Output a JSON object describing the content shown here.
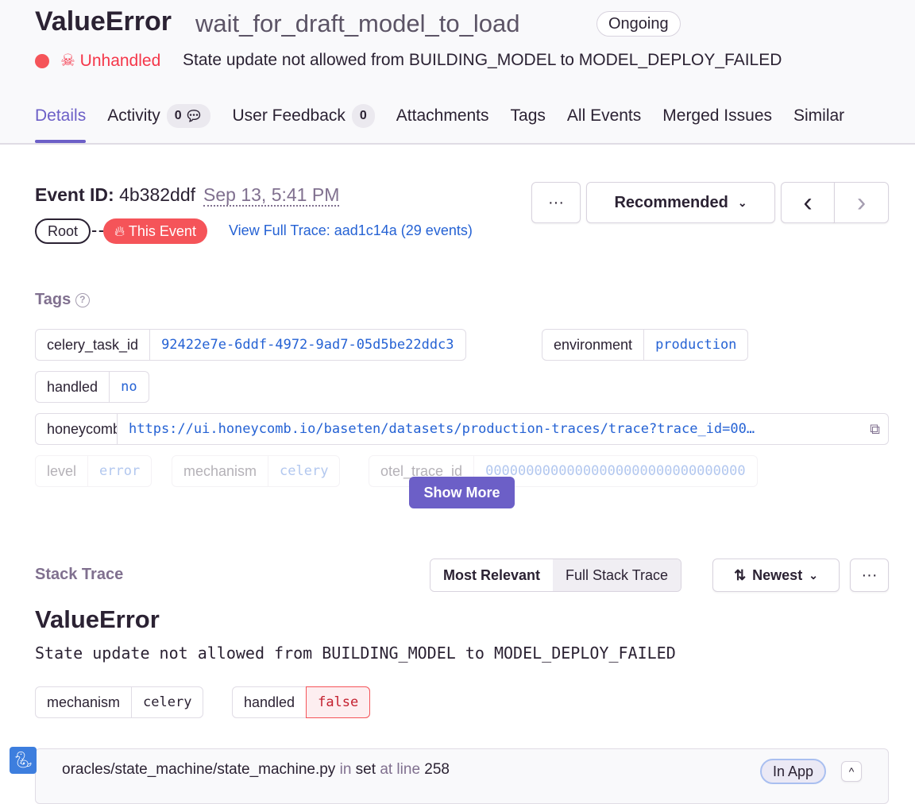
{
  "header": {
    "title": "ValueError",
    "culprit": "wait_for_draft_model_to_load",
    "status_badge": "Ongoing",
    "unhandled": "Unhandled",
    "message": "State update not allowed from BUILDING_MODEL to MODEL_DEPLOY_FAILED"
  },
  "tabs": [
    {
      "label": "Details"
    },
    {
      "label": "Activity",
      "count": "0"
    },
    {
      "label": "User Feedback",
      "count": "0"
    },
    {
      "label": "Attachments"
    },
    {
      "label": "Tags"
    },
    {
      "label": "All Events"
    },
    {
      "label": "Merged Issues"
    },
    {
      "label": "Similar"
    }
  ],
  "event": {
    "id_label": "Event ID:",
    "id": "4b382ddf",
    "date": "Sep 13, 5:41 PM",
    "more": "···",
    "sort": "Recommended",
    "prev": "‹",
    "next": "›",
    "root": "Root",
    "this_event": "This Event",
    "trace_link": "View Full Trace: aad1c14a (29 events)"
  },
  "tags": {
    "title": "Tags",
    "items": [
      {
        "key": "celery_task_id",
        "value": "92422e7e-6ddf-4972-9ad7-05d5be22ddc3"
      },
      {
        "key": "environment",
        "value": "production"
      },
      {
        "key": "handled",
        "value": "no"
      },
      {
        "key": "honeycomb",
        "value": "https://ui.honeycomb.io/baseten/datasets/production-traces/trace?trace_id=00…"
      },
      {
        "key": "level",
        "value": "error"
      },
      {
        "key": "mechanism",
        "value": "celery"
      },
      {
        "key": "otel_trace_id",
        "value": "00000000000000000000000000000000"
      }
    ],
    "show_more": "Show More"
  },
  "stack": {
    "title": "Stack Trace",
    "most_relevant": "Most Relevant",
    "full": "Full Stack Trace",
    "sort": "Newest",
    "more": "···",
    "exc_type": "ValueError",
    "exc_value": "State update not allowed from BUILDING_MODEL to MODEL_DEPLOY_FAILED",
    "mech": [
      {
        "key": "mechanism",
        "value": "celery"
      },
      {
        "key": "handled",
        "value": "false"
      }
    ],
    "frame": {
      "file": "oracles/state_machine/state_machine.py",
      "in": "in",
      "func": "set",
      "at": "at line",
      "line": "258",
      "badge": "In App"
    }
  },
  "colors": {
    "accent": "#6c5fc7",
    "error": "#f55459",
    "link": "#2562d4"
  }
}
